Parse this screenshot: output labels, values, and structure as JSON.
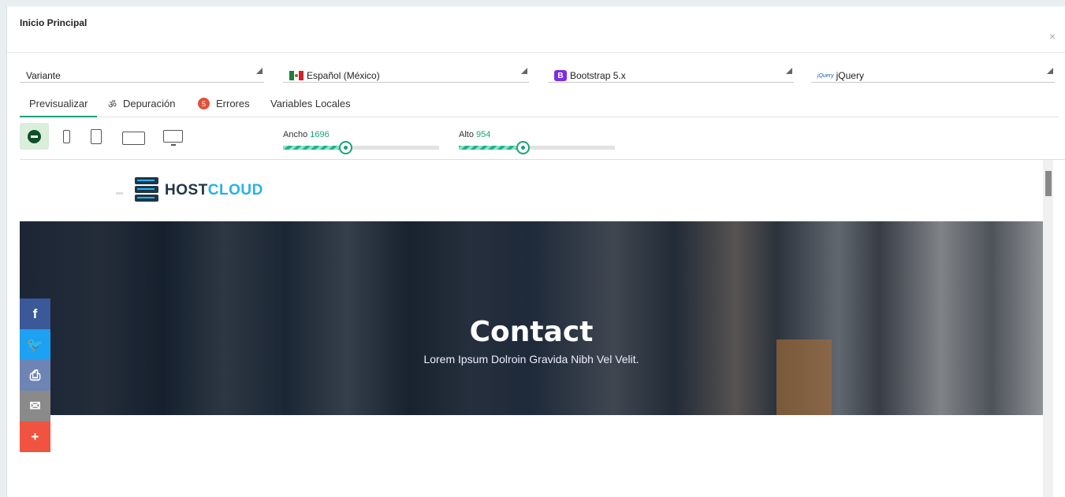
{
  "dialog": {
    "title": "Inicio Principal",
    "close_glyph": "×"
  },
  "selects": [
    {
      "value": "Variante",
      "icon": ""
    },
    {
      "value": "Español (México)",
      "icon": "mexico-flag-icon"
    },
    {
      "value": "Bootstrap 5.x",
      "icon": "bootstrap-icon"
    },
    {
      "value": "jQuery",
      "icon": "jquery-icon"
    }
  ],
  "icons": {
    "bootstrap_letter": "B",
    "jquery_wordmark": "jQuery"
  },
  "tabs": [
    {
      "label": "Previsualizar",
      "active": true
    },
    {
      "label": "Depuración",
      "icon": "bug-icon",
      "bug_glyph": "ॐ"
    },
    {
      "label": "Errores",
      "badge": "5"
    },
    {
      "label": "Variables Locales"
    }
  ],
  "sliders": {
    "width": {
      "label": "Ancho",
      "value": "1696",
      "level": 0.38
    },
    "height": {
      "label": "Alto",
      "value": "954",
      "level": 0.39
    }
  },
  "preview": {
    "logo_host": "HOST",
    "logo_cloud": "CLOUD",
    "hero_title": "Contact",
    "hero_subtitle": "Lorem Ipsum Dolroin Gravida Nibh Vel Velit.",
    "social": [
      {
        "name": "facebook",
        "glyph": "f",
        "color": "#3b5998"
      },
      {
        "name": "twitter",
        "glyph": "🐦",
        "color": "#1da1f2"
      },
      {
        "name": "print",
        "glyph": "⎙",
        "color": "#6d84b4"
      },
      {
        "name": "email",
        "glyph": "✉",
        "color": "#8a8a8a"
      },
      {
        "name": "share",
        "glyph": "+",
        "color": "#f0533f"
      }
    ]
  },
  "colors": {
    "accent": "#1aa37a",
    "badge": "#e0503a"
  }
}
